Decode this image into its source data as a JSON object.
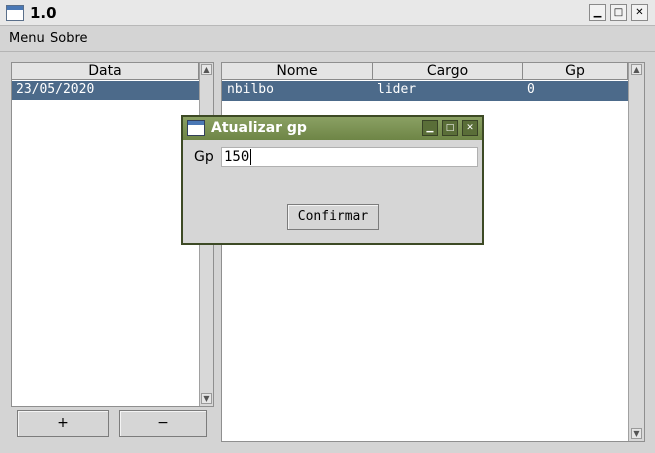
{
  "window": {
    "title": "1.0",
    "controls": {
      "minimize": "▁",
      "maximize": "□",
      "close": "✕"
    }
  },
  "menubar": {
    "items": [
      "Menu",
      "Sobre"
    ]
  },
  "left_table": {
    "header": "Data",
    "rows": [
      {
        "data": "23/05/2020",
        "selected": true
      }
    ],
    "add_label": "+",
    "remove_label": "−"
  },
  "right_table": {
    "columns": [
      "Nome",
      "Cargo",
      "Gp"
    ],
    "rows": [
      {
        "nome": "nbilbo",
        "cargo": "lider",
        "gp": "0",
        "selected": true
      }
    ]
  },
  "dialog": {
    "title": "Atualizar gp",
    "field_label": "Gp",
    "field_value": "150",
    "confirm_label": "Confirmar",
    "controls": {
      "minimize": "▁",
      "maximize": "□",
      "close": "✕"
    }
  },
  "colors": {
    "selection": "#4c6a8a",
    "dialog_title": "#7a904f",
    "window_bg": "#d4d4d4"
  }
}
